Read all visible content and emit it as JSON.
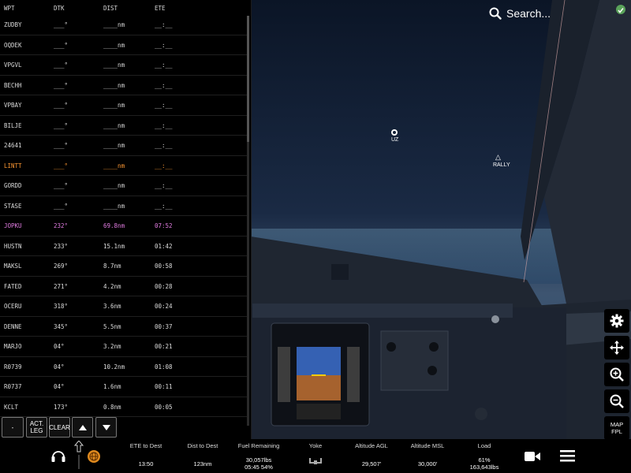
{
  "search": {
    "label": "Search..."
  },
  "fpl": {
    "headers": {
      "wpt": "WPT",
      "dtk": "DTK",
      "dist": "DIST",
      "ete": "ETE"
    },
    "rows": [
      {
        "wpt": "ZUDBY",
        "dtk": "___°",
        "dist": "____nm",
        "ete": "__:__",
        "state": "past"
      },
      {
        "wpt": "OQDEK",
        "dtk": "___°",
        "dist": "____nm",
        "ete": "__:__",
        "state": "past"
      },
      {
        "wpt": "VPGVL",
        "dtk": "___°",
        "dist": "____nm",
        "ete": "__:__",
        "state": "past"
      },
      {
        "wpt": "BECHH",
        "dtk": "___°",
        "dist": "____nm",
        "ete": "__:__",
        "state": "past"
      },
      {
        "wpt": "VPBAY",
        "dtk": "___°",
        "dist": "____nm",
        "ete": "__:__",
        "state": "past"
      },
      {
        "wpt": "BILJE",
        "dtk": "___°",
        "dist": "____nm",
        "ete": "__:__",
        "state": "past"
      },
      {
        "wpt": "24641",
        "dtk": "___°",
        "dist": "____nm",
        "ete": "__:__",
        "state": "past"
      },
      {
        "wpt": "LINTT",
        "dtk": "___°",
        "dist": "____nm",
        "ete": "__:__",
        "state": "active"
      },
      {
        "wpt": "GORDD",
        "dtk": "___°",
        "dist": "____nm",
        "ete": "__:__",
        "state": "past"
      },
      {
        "wpt": "STASE",
        "dtk": "___°",
        "dist": "____nm",
        "ete": "__:__",
        "state": "past"
      },
      {
        "wpt": "JOPKU",
        "dtk": "232°",
        "dist": "69.8nm",
        "ete": "07:52",
        "state": "next"
      },
      {
        "wpt": "HUSTN",
        "dtk": "233°",
        "dist": "15.1nm",
        "ete": "01:42",
        "state": "future"
      },
      {
        "wpt": "MAKSL",
        "dtk": "269°",
        "dist": "8.7nm",
        "ete": "00:58",
        "state": "future"
      },
      {
        "wpt": "FATED",
        "dtk": "271°",
        "dist": "4.2nm",
        "ete": "00:28",
        "state": "future"
      },
      {
        "wpt": "OCERU",
        "dtk": "318°",
        "dist": "3.6nm",
        "ete": "00:24",
        "state": "future"
      },
      {
        "wpt": "DENNE",
        "dtk": "345°",
        "dist": "5.5nm",
        "ete": "00:37",
        "state": "future"
      },
      {
        "wpt": "MARJO",
        "dtk": "04°",
        "dist": "3.2nm",
        "ete": "00:21",
        "state": "future"
      },
      {
        "wpt": "R0739",
        "dtk": "04°",
        "dist": "10.2nm",
        "ete": "01:08",
        "state": "future"
      },
      {
        "wpt": "R0737",
        "dtk": "04°",
        "dist": "1.6nm",
        "ete": "00:11",
        "state": "future"
      },
      {
        "wpt": "KCLT",
        "dtk": "173°",
        "dist": "0.8nm",
        "ete": "00:05",
        "state": "future"
      }
    ],
    "buttons": {
      "minus": "-",
      "act_leg_1": "ACT.",
      "act_leg_2": "LEG",
      "clear": "CLEAR"
    }
  },
  "map": {
    "waypoint_uz": "UZ",
    "waypoint_rally": "RALLY"
  },
  "side": {
    "map_fpl_1": "MAP",
    "map_fpl_2": "FPL"
  },
  "bottom": {
    "ete_dest": {
      "label": "ETE to Dest",
      "value": "13:50"
    },
    "dist_dest": {
      "label": "Dist to Dest",
      "value": "123nm"
    },
    "fuel": {
      "label": "Fuel Remaining",
      "value1": "30,057lbs",
      "value2": "05:45 54%"
    },
    "yoke": {
      "label": "Yoke"
    },
    "alt_agl": {
      "label": "Altitude AGL",
      "value": "29,507'"
    },
    "alt_msl": {
      "label": "Altitude MSL",
      "value": "30,000'"
    },
    "load": {
      "label": "Load",
      "value1": "61%",
      "value2": "163,643lbs"
    }
  },
  "colors": {
    "active_leg": "#ff9933",
    "next_leg": "#e07be0",
    "status_ok": "#5aa35a"
  }
}
